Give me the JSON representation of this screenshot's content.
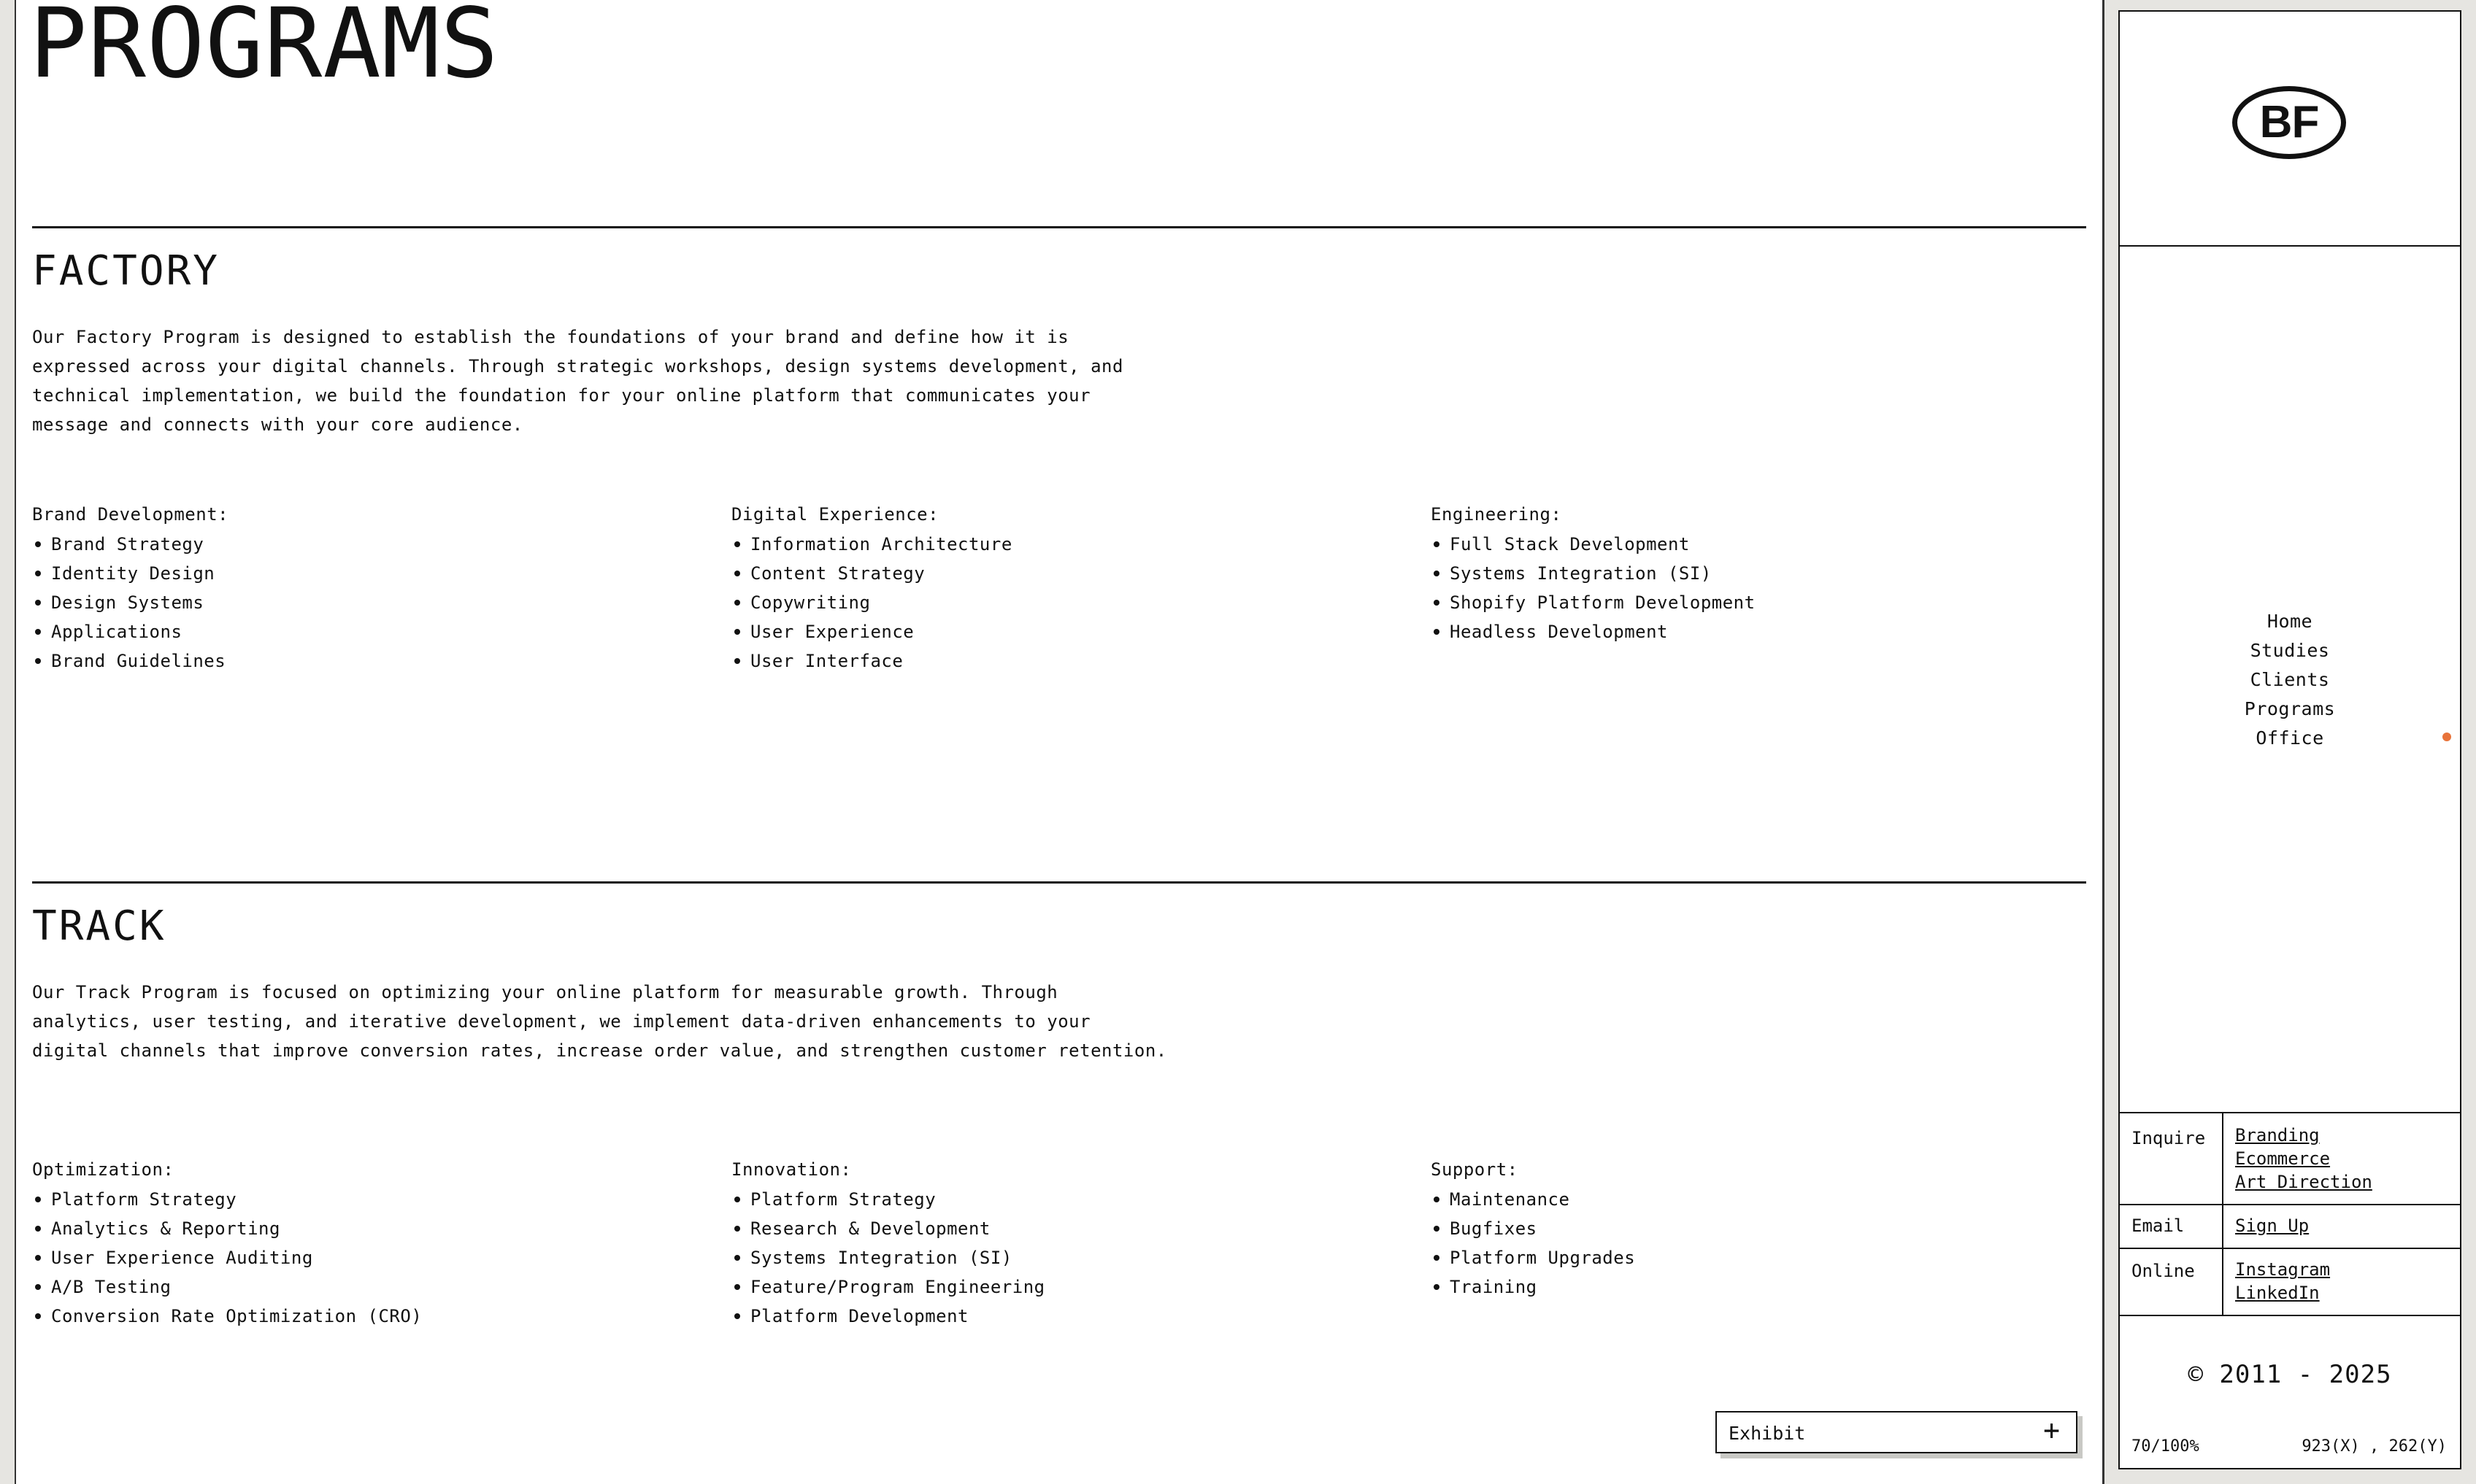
{
  "page_title": "PROGRAMS",
  "sections": [
    {
      "title": "FACTORY",
      "description": "Our Factory Program is designed to establish the foundations of your brand and define how it is expressed across your digital channels. Through strategic workshops, design systems development, and technical implementation, we build the foundation for your online platform that communicates your message and connects with your core audience.",
      "columns": [
        {
          "title": "Brand Development:",
          "items": [
            "Brand Strategy",
            "Identity Design",
            "Design Systems",
            "Applications",
            "Brand Guidelines"
          ]
        },
        {
          "title": "Digital Experience:",
          "items": [
            "Information Architecture",
            "Content Strategy",
            "Copywriting",
            "User Experience",
            "User Interface"
          ]
        },
        {
          "title": "Engineering:",
          "items": [
            "Full Stack Development",
            "Systems Integration (SI)",
            "Shopify Platform Development",
            "Headless Development"
          ]
        }
      ]
    },
    {
      "title": "TRACK",
      "description": "Our Track Program is focused on optimizing your online platform for measurable growth. Through analytics, user testing, and iterative development, we implement data-driven enhancements to your digital channels that improve conversion rates, increase order value, and strengthen customer retention.",
      "columns": [
        {
          "title": "Optimization:",
          "items": [
            "Platform Strategy",
            "Analytics & Reporting",
            "User Experience Auditing",
            "A/B Testing",
            "Conversion Rate Optimization (CRO)"
          ]
        },
        {
          "title": "Innovation:",
          "items": [
            "Platform Strategy",
            "Research & Development",
            "Systems Integration (SI)",
            "Feature/Program Engineering",
            "Platform Development"
          ]
        },
        {
          "title": "Support:",
          "items": [
            "Maintenance",
            "Bugfixes",
            "Platform Upgrades",
            "Training"
          ]
        }
      ]
    }
  ],
  "exhibit": {
    "label": "Exhibit",
    "icon": "+"
  },
  "sidebar": {
    "logo_text": "BF",
    "nav": [
      "Home",
      "Studies",
      "Clients",
      "Programs",
      "Office"
    ],
    "active_indicator_color": "#e8733a",
    "inquire": {
      "label": "Inquire",
      "links": [
        "Branding",
        "Ecommerce",
        "Art Direction"
      ]
    },
    "email": {
      "label": "Email",
      "links": [
        "Sign Up"
      ]
    },
    "online": {
      "label": "Online",
      "links": [
        "Instagram",
        "LinkedIn"
      ]
    },
    "copyright": "© 2011 - 2025",
    "zoom": "70/100%",
    "coords": "923(X) , 262(Y)"
  }
}
